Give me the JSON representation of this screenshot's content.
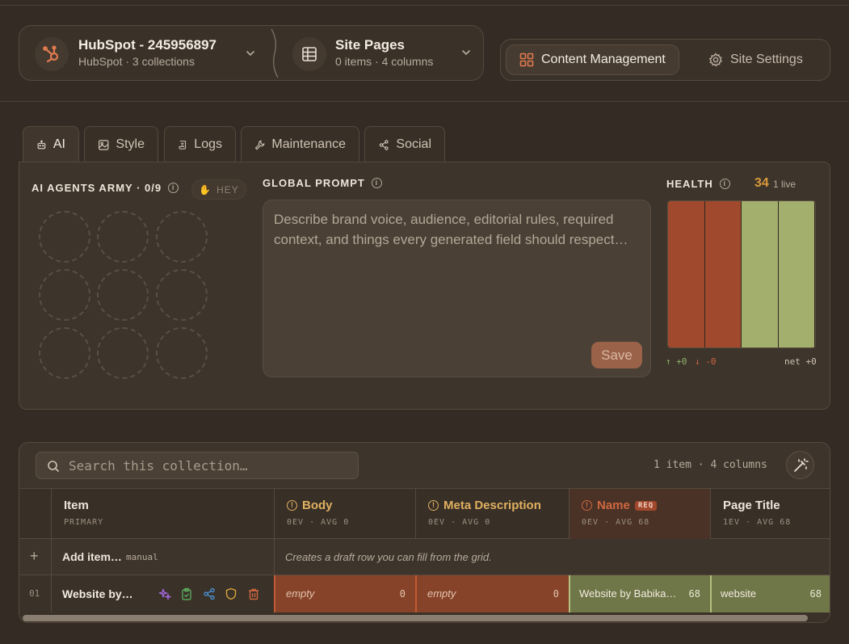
{
  "source": {
    "title": "HubSpot - 245956897",
    "subtitle": "HubSpot · 3 collections",
    "icon": "hubspot-icon"
  },
  "collection": {
    "title": "Site Pages",
    "subtitle": "0 items · 4 columns",
    "icon": "table-icon"
  },
  "nav": {
    "content_management": "Content Management",
    "site_settings": "Site Settings"
  },
  "tabs": [
    {
      "label": "AI",
      "icon": "robot-icon"
    },
    {
      "label": "Style",
      "icon": "image-icon"
    },
    {
      "label": "Logs",
      "icon": "scroll-icon"
    },
    {
      "label": "Maintenance",
      "icon": "wrench-icon"
    },
    {
      "label": "Social",
      "icon": "share-icon"
    }
  ],
  "agents": {
    "heading": "AI AGENTS ARMY · 0/9",
    "hey_label": "HEY",
    "slots": 9
  },
  "prompt": {
    "heading": "GLOBAL PROMPT",
    "placeholder": "Describe brand voice, audience, editorial rules, required context, and things every generated field should respect…",
    "save_label": "Save"
  },
  "health": {
    "heading": "HEALTH",
    "score": "34",
    "live": "1 live",
    "bars": [
      {
        "status": "bad",
        "color": "#a0492c",
        "level": 1.0
      },
      {
        "status": "bad",
        "color": "#a0492c",
        "level": 1.0
      },
      {
        "status": "good",
        "color": "#a3b06d",
        "level": 1.0
      },
      {
        "status": "good",
        "color": "#a3b06d",
        "level": 1.0
      }
    ],
    "up": "↑ +0",
    "down": "↓ -0",
    "net": "net +0"
  },
  "table": {
    "search_placeholder": "Search this collection…",
    "count": "1 item · 4 columns",
    "columns": [
      {
        "title": "Item",
        "sub": "PRIMARY"
      },
      {
        "title": "Body",
        "sub": "0EV · AVG 0"
      },
      {
        "title": "Meta Description",
        "sub": "0EV · AVG 0"
      },
      {
        "title": "Name",
        "sub": "0EV · AVG 68",
        "badge": "REQ"
      },
      {
        "title": "Page Title",
        "sub": "1EV · AVG 68"
      }
    ],
    "add_row": {
      "plus": "+",
      "label": "Add item…",
      "tag": "manual",
      "hint": "Creates a draft row you can fill from the grid."
    },
    "rows": [
      {
        "index": "01",
        "item": "Website by…",
        "body": {
          "text": "empty",
          "score": "0"
        },
        "meta": {
          "text": "empty",
          "score": "0"
        },
        "name": {
          "text": "Website by Babika…",
          "score": "68"
        },
        "page_title": {
          "text": "website",
          "score": "68"
        }
      }
    ]
  },
  "colors": {
    "accent": "#e07a4f",
    "warning": "#e0b060",
    "bad": "#a0492c",
    "good": "#a3b06d"
  }
}
